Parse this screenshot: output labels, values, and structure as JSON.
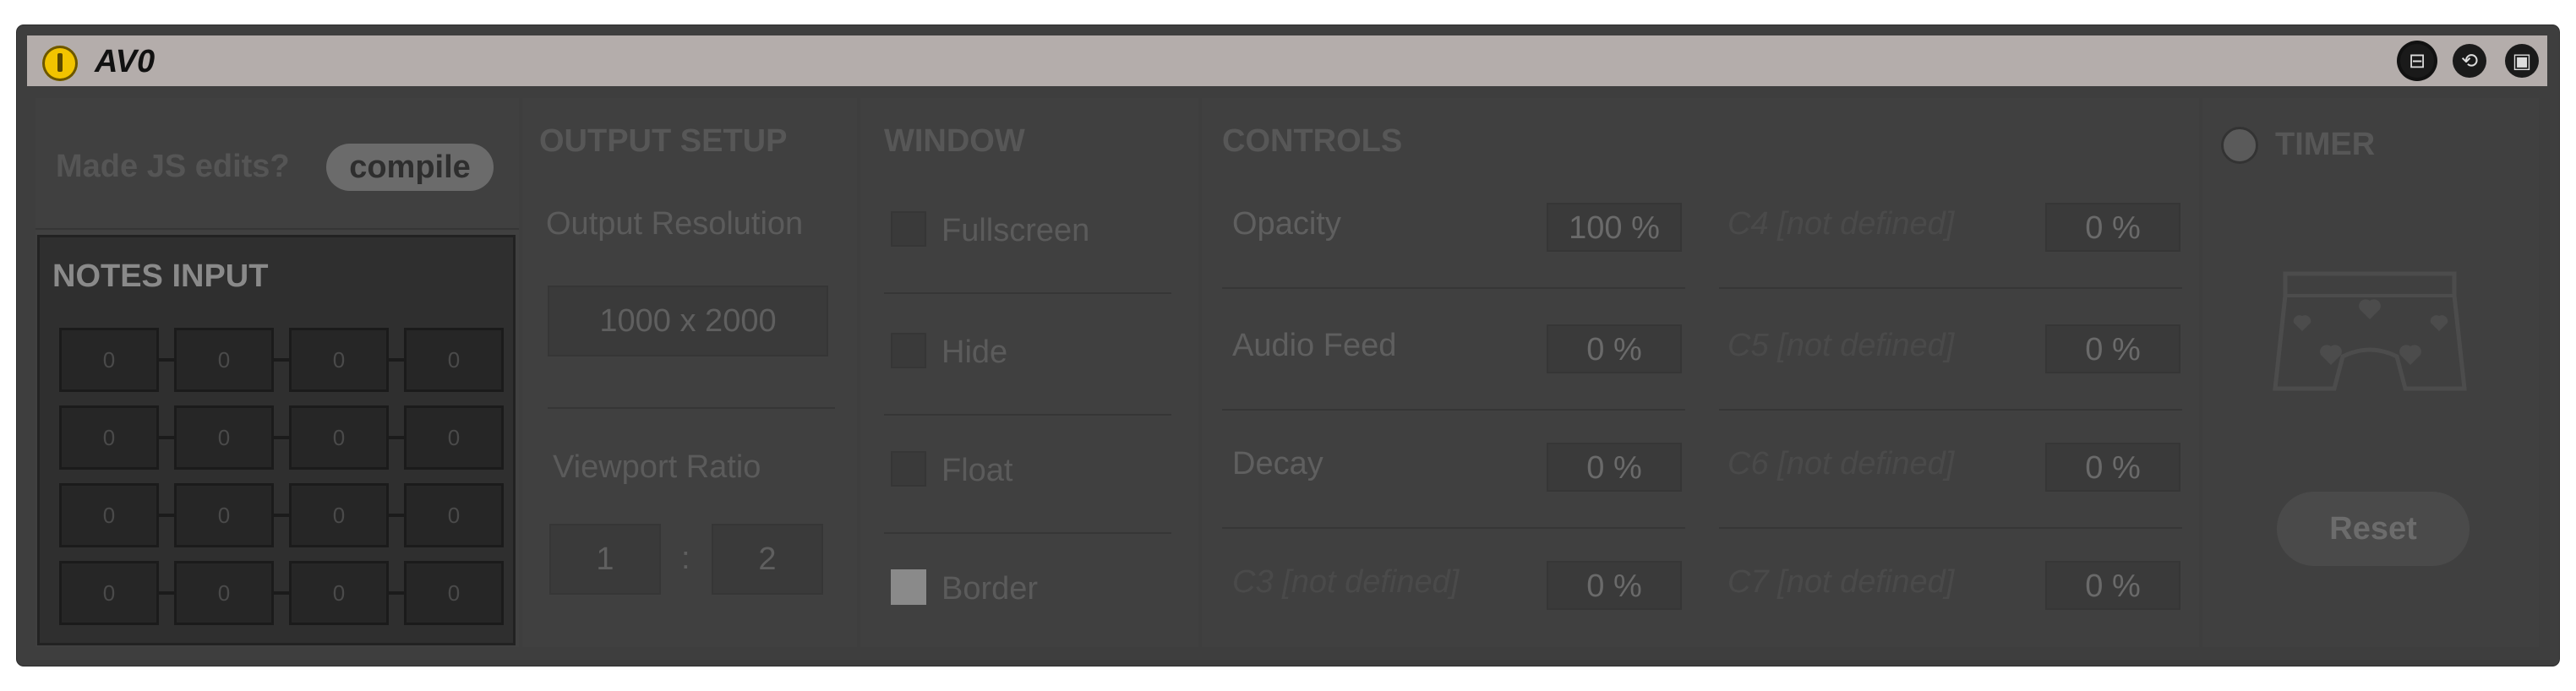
{
  "title": "AV0",
  "titlebar_icons": [
    "device-frame-icon",
    "refresh-icon",
    "save-icon"
  ],
  "left": {
    "prompt": "Made JS edits?",
    "compile_label": "compile",
    "notes_title": "NOTES INPUT",
    "notes": [
      [
        "0",
        "0",
        "0",
        "0"
      ],
      [
        "0",
        "0",
        "0",
        "0"
      ],
      [
        "0",
        "0",
        "0",
        "0"
      ],
      [
        "0",
        "0",
        "0",
        "0"
      ]
    ]
  },
  "output": {
    "title": "OUTPUT SETUP",
    "resolution_label": "Output Resolution",
    "resolution_value": "1000 x 2000",
    "ratio_label": "Viewport Ratio",
    "ratio_a": "1",
    "ratio_sep": ":",
    "ratio_b": "2"
  },
  "window": {
    "title": "WINDOW",
    "options": [
      {
        "label": "Fullscreen",
        "checked": false
      },
      {
        "label": "Hide",
        "checked": false
      },
      {
        "label": "Float",
        "checked": false
      },
      {
        "label": "Border",
        "checked": true
      }
    ]
  },
  "controls": {
    "title": "CONTROLS",
    "left": [
      {
        "label": "Opacity",
        "value": "100 %"
      },
      {
        "label": "Audio Feed",
        "value": "0 %"
      },
      {
        "label": "Decay",
        "value": "0 %"
      },
      {
        "label": "C3 [not defined]",
        "value": "0 %"
      }
    ],
    "right": [
      {
        "label": "C4 [not defined]",
        "value": "0 %"
      },
      {
        "label": "C5 [not defined]",
        "value": "0 %"
      },
      {
        "label": "C6 [not defined]",
        "value": "0 %"
      },
      {
        "label": "C7 [not defined]",
        "value": "0 %"
      }
    ]
  },
  "timer": {
    "title": "TIMER",
    "reset_label": "Reset",
    "image_icon": "underwear-hearts-icon"
  },
  "colors": {
    "titlebar": "#b4adab",
    "power": "#f2c400",
    "body": "#404040"
  }
}
